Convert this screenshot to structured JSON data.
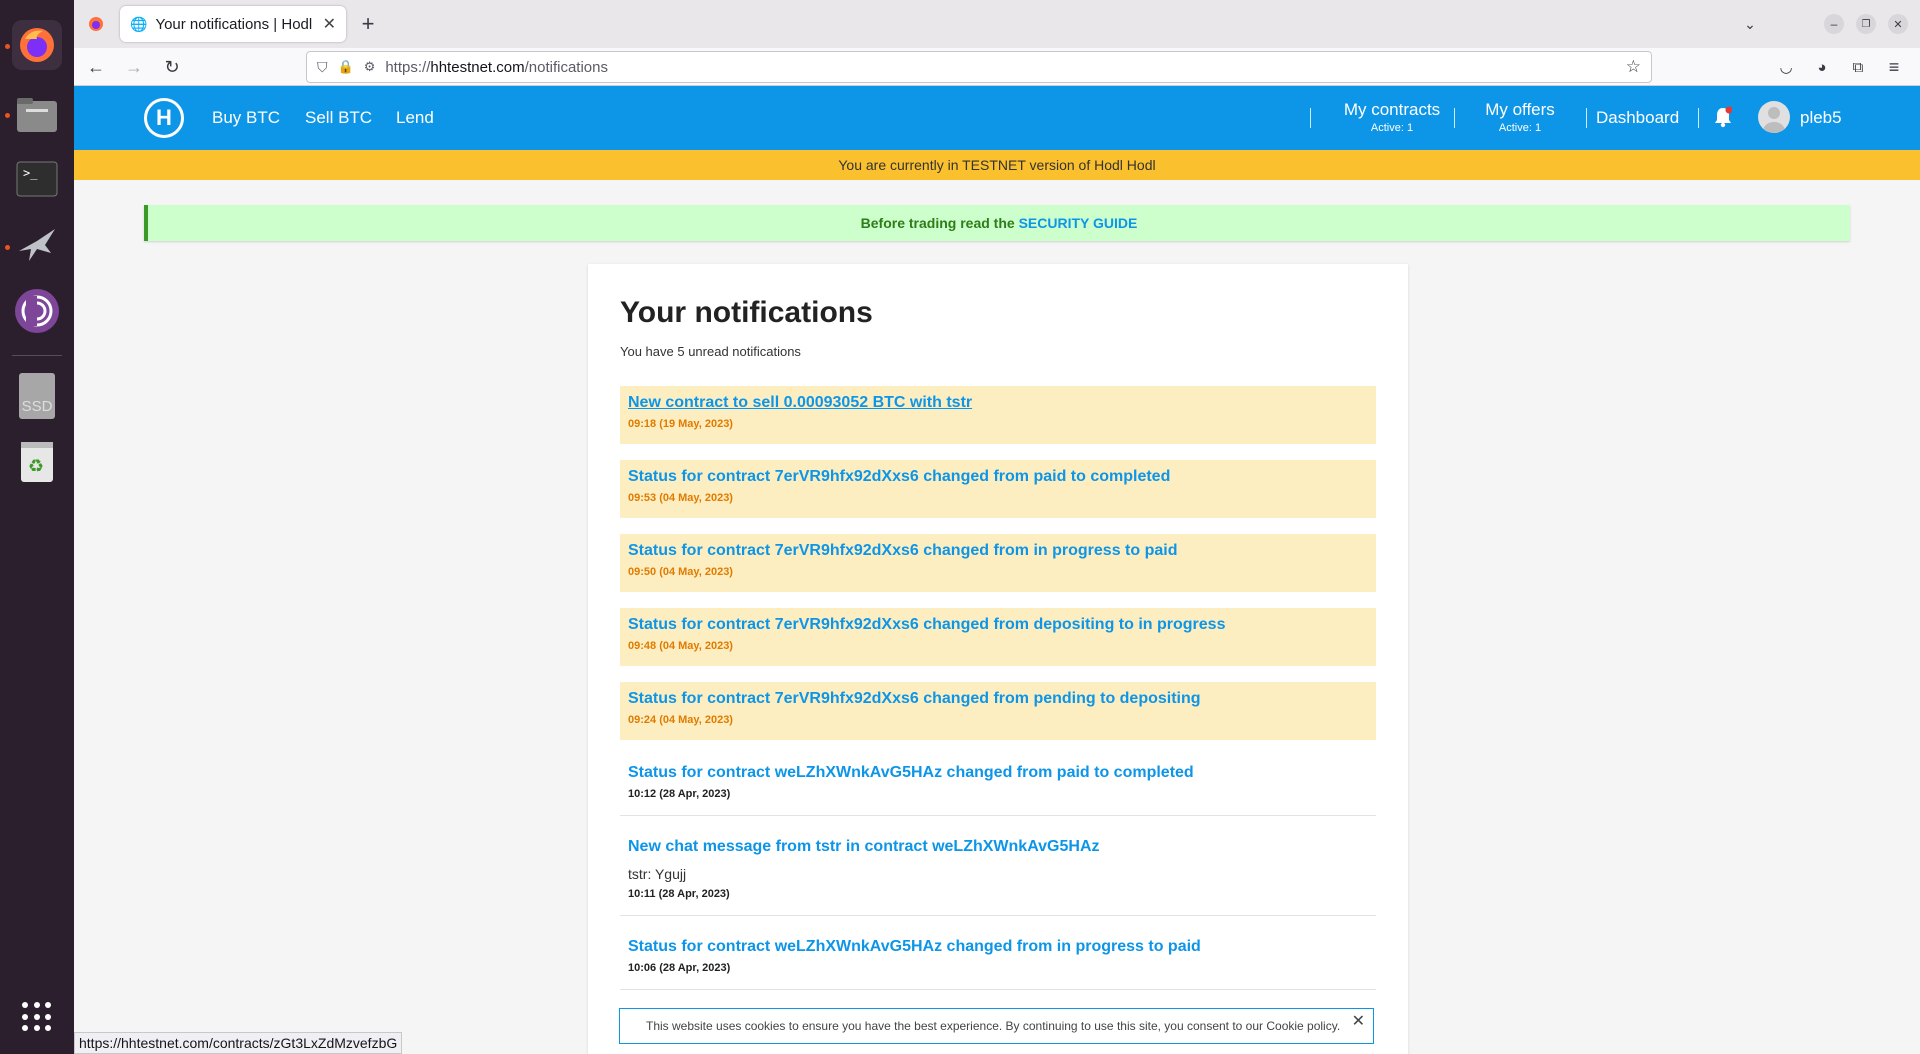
{
  "browser": {
    "tab_title": "Your notifications | Hodl",
    "url_prefix": "https://",
    "url_host": "hhtestnet.com",
    "url_path": "/notifications",
    "status_url": "https://hhtestnet.com/contracts/zGt3LxZdMzvefzbG"
  },
  "dock": {
    "ssd_label": "SSD"
  },
  "header": {
    "logo": "H",
    "nav": [
      "Buy BTC",
      "Sell BTC",
      "Lend"
    ],
    "my_contracts": "My contracts",
    "my_contracts_sub": "Active: 1",
    "my_offers": "My offers",
    "my_offers_sub": "Active: 1",
    "dashboard": "Dashboard",
    "username": "pleb5"
  },
  "testnet_banner": "You are currently in TESTNET version of Hodl Hodl",
  "security": {
    "prefix": "Before trading read the ",
    "link": "SECURITY GUIDE"
  },
  "main": {
    "title": "Your notifications",
    "unread_text": "You have 5 unread notifications",
    "notifications": [
      {
        "title": "New contract to sell 0.00093052 BTC with tstr",
        "time": "09:18 (19 May, 2023)"
      },
      {
        "title": "Status for contract 7erVR9hfx92dXxs6 changed from paid to completed",
        "time": "09:53 (04 May, 2023)"
      },
      {
        "title": "Status for contract 7erVR9hfx92dXxs6 changed from in progress to paid",
        "time": "09:50 (04 May, 2023)"
      },
      {
        "title": "Status for contract 7erVR9hfx92dXxs6 changed from depositing to in progress",
        "time": "09:48 (04 May, 2023)"
      },
      {
        "title": "Status for contract 7erVR9hfx92dXxs6 changed from pending to depositing",
        "time": "09:24 (04 May, 2023)"
      },
      {
        "title": "Status for contract weLZhXWnkAvG5HAz changed from paid to completed",
        "time": "10:12 (28 Apr, 2023)"
      },
      {
        "title": "New chat message from tstr in contract weLZhXWnkAvG5HAz",
        "body": "tstr: Ygujj",
        "time": "10:11 (28 Apr, 2023)"
      },
      {
        "title": "Status for contract weLZhXWnkAvG5HAz changed from in progress to paid",
        "time": "10:06 (28 Apr, 2023)"
      }
    ]
  },
  "cookie_text": "This website uses cookies to ensure you have the best experience. By continuing to use this site, you consent to our Cookie policy.",
  "colors": {
    "brand_blue": "#0d95e8",
    "testnet_yellow": "#fbc02d",
    "unread_bg": "#fdeec2"
  }
}
